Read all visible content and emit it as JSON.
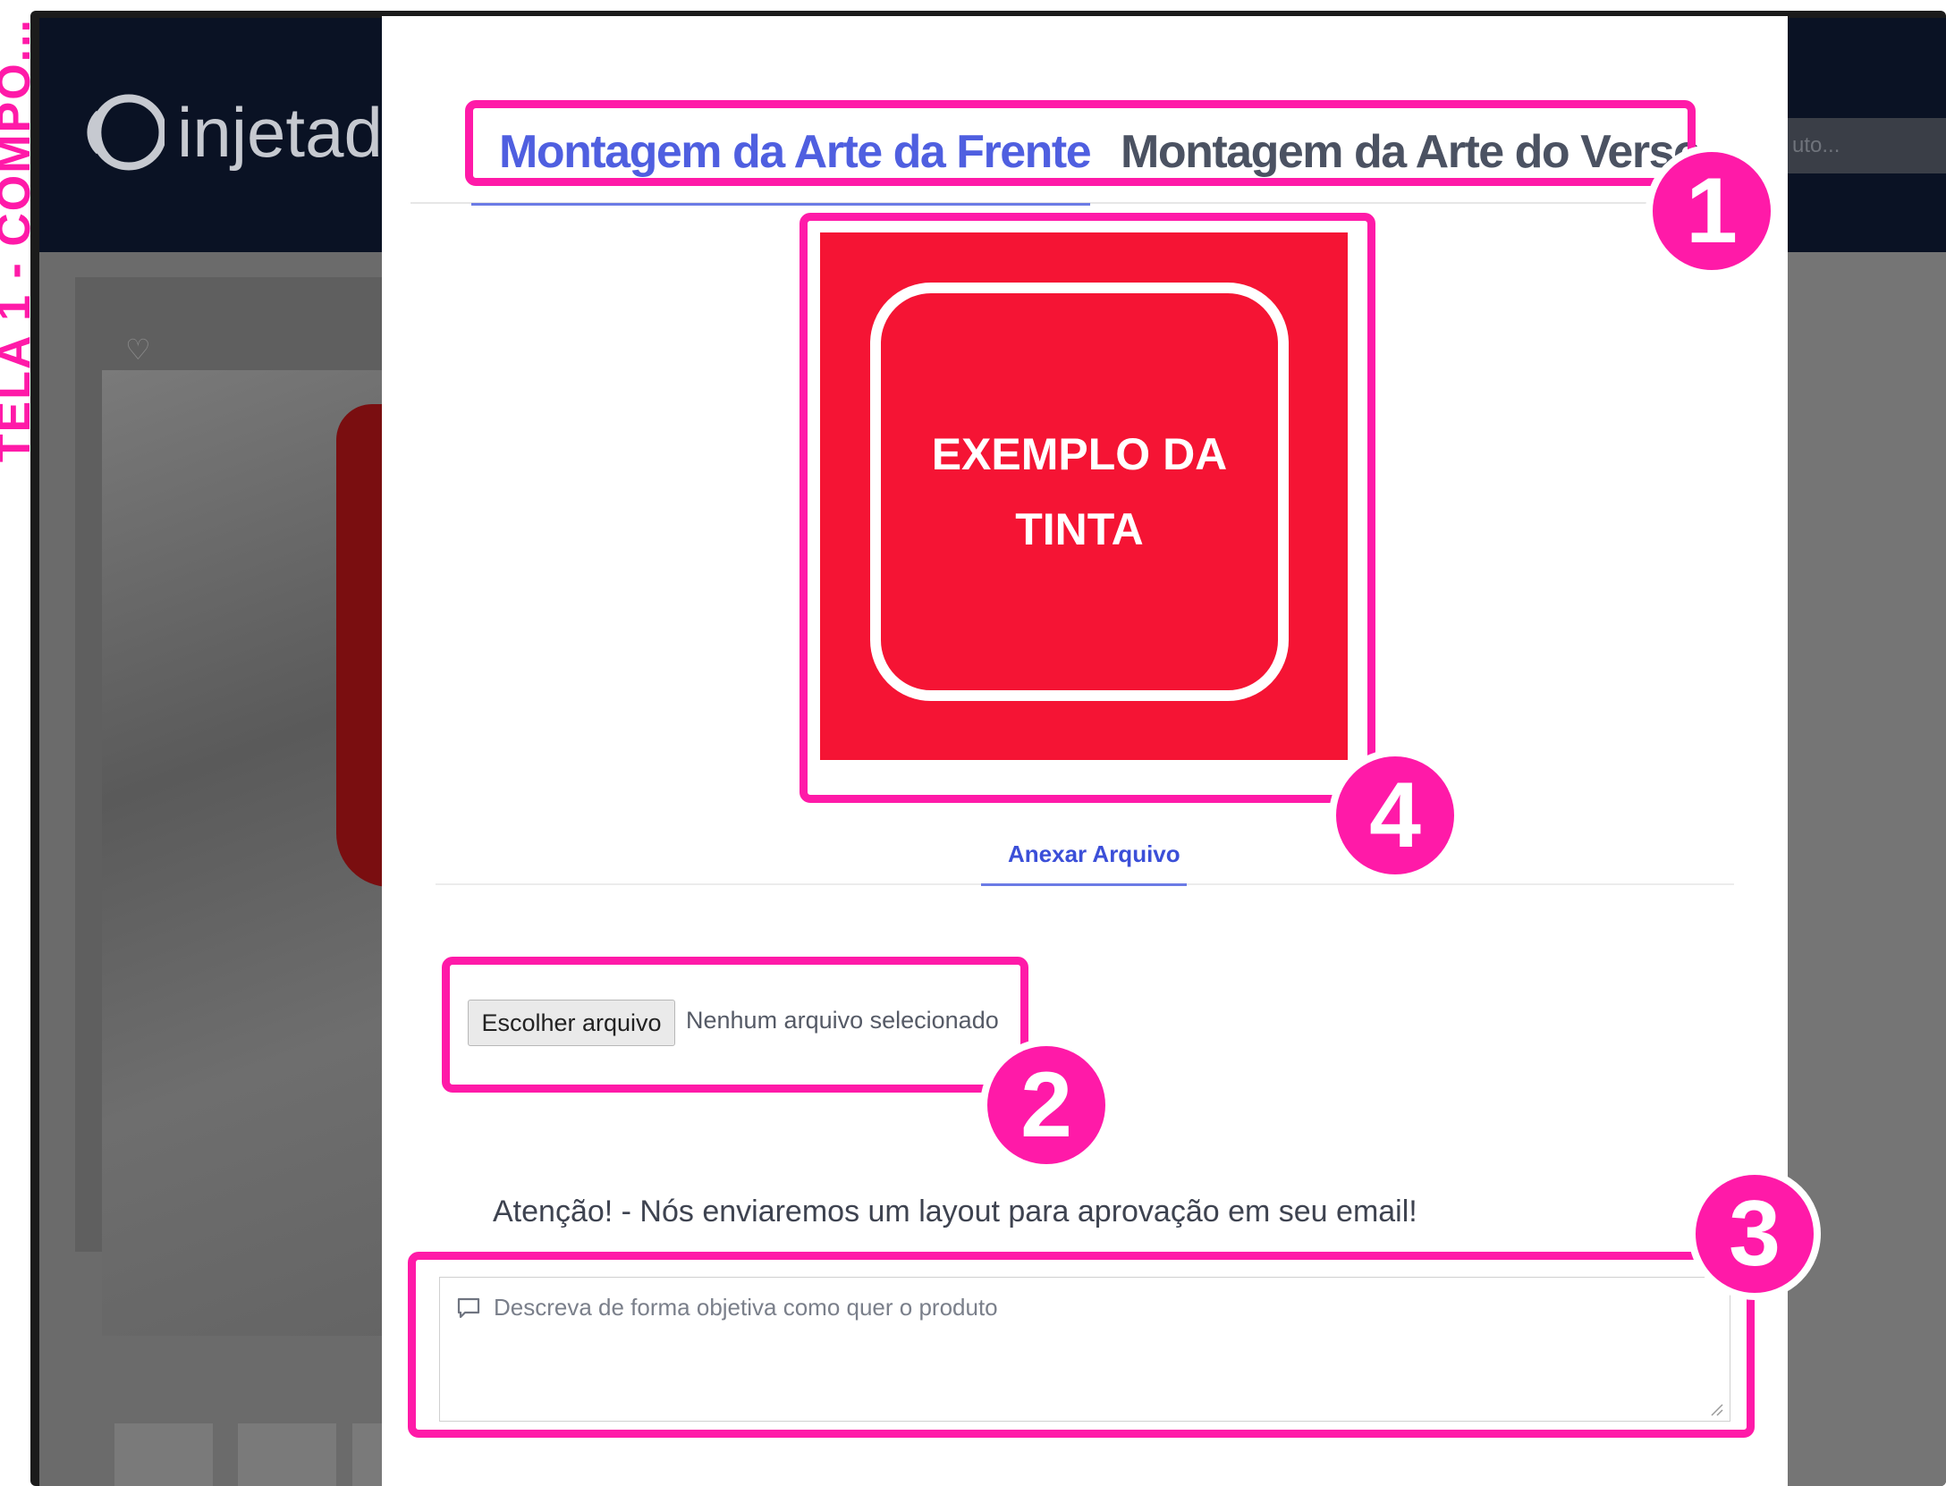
{
  "left_strip": {
    "text": "TELA 1 - COMPO..."
  },
  "site": {
    "logo_text": "injetad",
    "search_placeholder": "uto..."
  },
  "modal": {
    "tabs": [
      {
        "label": "Montagem da Arte da Frente",
        "active": true
      },
      {
        "label": "Montagem da Arte do Verso",
        "active": false
      }
    ],
    "preview": {
      "line1": "EXEMPLO DA",
      "line2": "TINTA",
      "color": "#f51434"
    },
    "attach_link": "Anexar Arquivo",
    "file_input": {
      "button_label": "Escolher arquivo",
      "status": "Nenhum arquivo selecionado"
    },
    "notice": "Atenção! - Nós enviaremos um layout para aprovação em seu email!",
    "description": {
      "placeholder": "Descreva de forma objetiva como quer o produto"
    }
  },
  "annotations": {
    "badges": [
      "1",
      "2",
      "3",
      "4"
    ],
    "color": "#ff1aa8"
  }
}
